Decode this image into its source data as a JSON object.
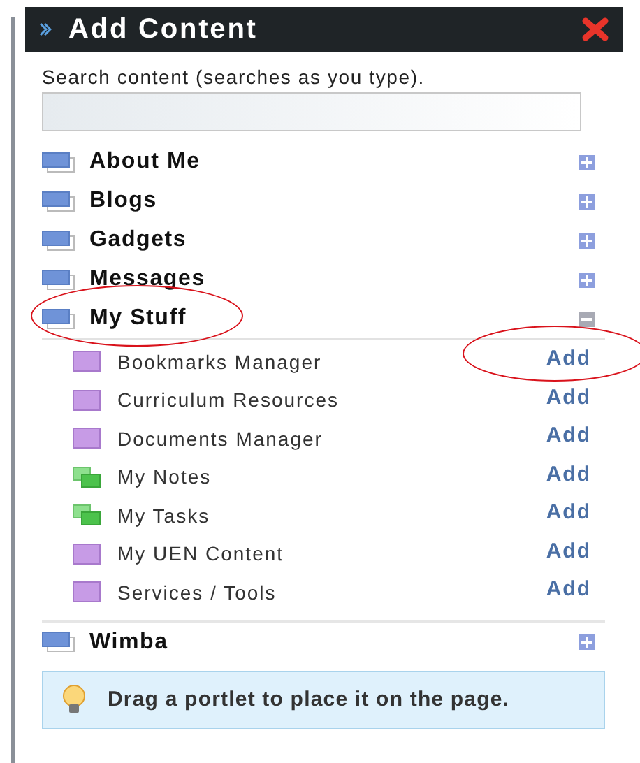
{
  "panel": {
    "title": "Add Content"
  },
  "search": {
    "label": "Search content (searches as you type)."
  },
  "categories": [
    {
      "name": "About Me",
      "expanded": false,
      "highlighted": false
    },
    {
      "name": "Blogs",
      "expanded": false,
      "highlighted": false
    },
    {
      "name": "Gadgets",
      "expanded": false,
      "highlighted": false
    },
    {
      "name": "Messages",
      "expanded": false,
      "highlighted": false
    },
    {
      "name": "My Stuff",
      "expanded": true,
      "highlighted": true,
      "children": [
        {
          "name": "Bookmarks Manager",
          "kind": "single",
          "action": "Add",
          "highlighted": true
        },
        {
          "name": "Curriculum Resources",
          "kind": "single",
          "action": "Add",
          "highlighted": false
        },
        {
          "name": "Documents Manager",
          "kind": "single",
          "action": "Add",
          "highlighted": false
        },
        {
          "name": "My Notes",
          "kind": "stacked",
          "action": "Add",
          "highlighted": false
        },
        {
          "name": "My Tasks",
          "kind": "stacked",
          "action": "Add",
          "highlighted": false
        },
        {
          "name": "My UEN Content",
          "kind": "single",
          "action": "Add",
          "highlighted": false
        },
        {
          "name": "Services / Tools",
          "kind": "single",
          "action": "Add",
          "highlighted": false
        }
      ]
    },
    {
      "name": "Wimba",
      "expanded": false,
      "highlighted": false
    }
  ],
  "tip": {
    "text": "Drag a portlet to place it on the page."
  }
}
